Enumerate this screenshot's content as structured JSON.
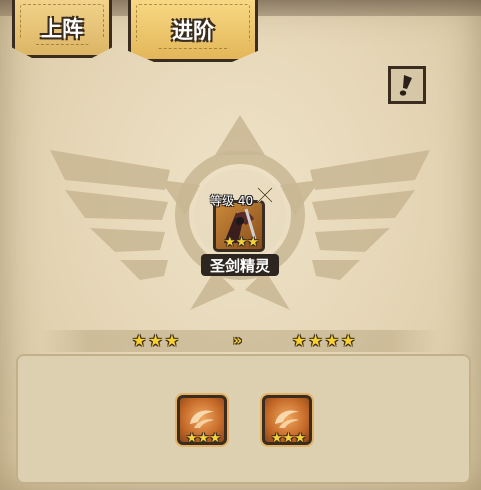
{
  "tabs": [
    {
      "label": "上阵",
      "active": false
    },
    {
      "label": "进阶",
      "active": true
    }
  ],
  "info_button": {
    "icon": "exclamation-icon"
  },
  "hero": {
    "level_text": "等级 40",
    "name": "圣剑精灵",
    "stars": 3,
    "weapon_icon": "crossed-swords-icon"
  },
  "upgrade": {
    "current_stars": 3,
    "next_stars": 4,
    "arrow_icon": "double-arrow-icon"
  },
  "materials": [
    {
      "icon": "wing-emblem-icon",
      "stars": 3
    },
    {
      "icon": "wing-emblem-icon",
      "stars": 3
    }
  ],
  "colors": {
    "tab_gold": "#e8bd5f",
    "outline": "#3a2c1e",
    "star_gold": "#f6d23a",
    "parchment": "#e6d7b8"
  }
}
